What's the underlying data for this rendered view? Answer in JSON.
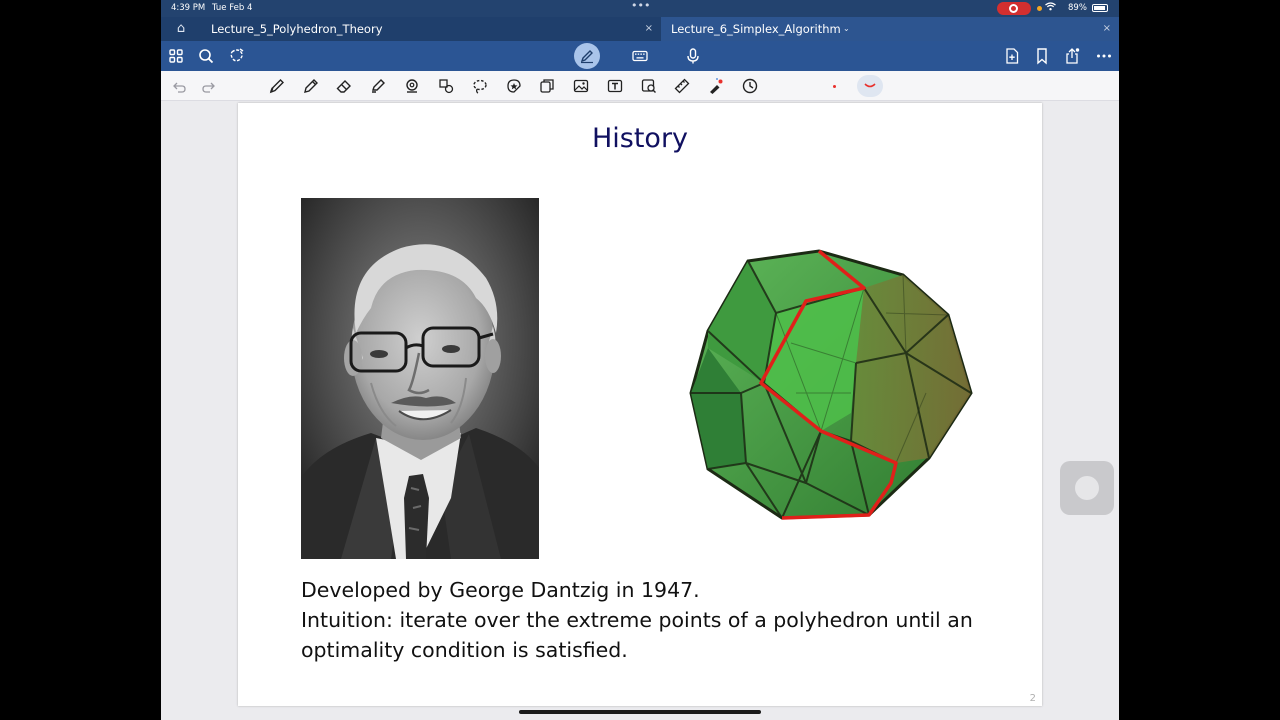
{
  "status_bar": {
    "time": "4:39 PM",
    "date": "Tue Feb 4",
    "multitask_dots": "•••",
    "battery_percent": "89%"
  },
  "tabs": [
    {
      "label": "Lecture_5_Polyhedron_Theory",
      "close": "×",
      "active": false
    },
    {
      "label": "Lecture_6_Simplex_Algorithm",
      "close": "×",
      "active": true,
      "chevron": "⌄"
    }
  ],
  "home_icon": "⌂",
  "toolbar_icons": {
    "left": [
      "grid-icon",
      "search-icon",
      "lasso-share-icon"
    ],
    "center": [
      "pen-mode-icon",
      "keyboard-icon",
      "microphone-icon"
    ],
    "right": [
      "add-page-icon",
      "bookmark-icon",
      "share-icon",
      "more-icon"
    ]
  },
  "drawing_tools": [
    "undo-icon",
    "redo-icon",
    "pen-icon",
    "pencil-icon",
    "eraser-icon",
    "highlighter-icon",
    "shape-icon",
    "elements-icon",
    "lasso-icon",
    "sticker-icon",
    "copy-icon",
    "image-icon",
    "text-icon",
    "scan-icon",
    "ruler-icon",
    "laser-pointer-icon",
    "timer-icon"
  ],
  "colors": {
    "accent": "#2b5594",
    "tab_bar": "#1f3f6c",
    "active_ink": "#e8302c",
    "title_color": "#101060"
  },
  "slide": {
    "title": "History",
    "line1": "Developed by George Dantzig in 1947.",
    "line2": "Intuition: iterate over the extreme points of a polyhedron until an",
    "line3": "optimality condition is satisfied.",
    "page_number": "2"
  }
}
